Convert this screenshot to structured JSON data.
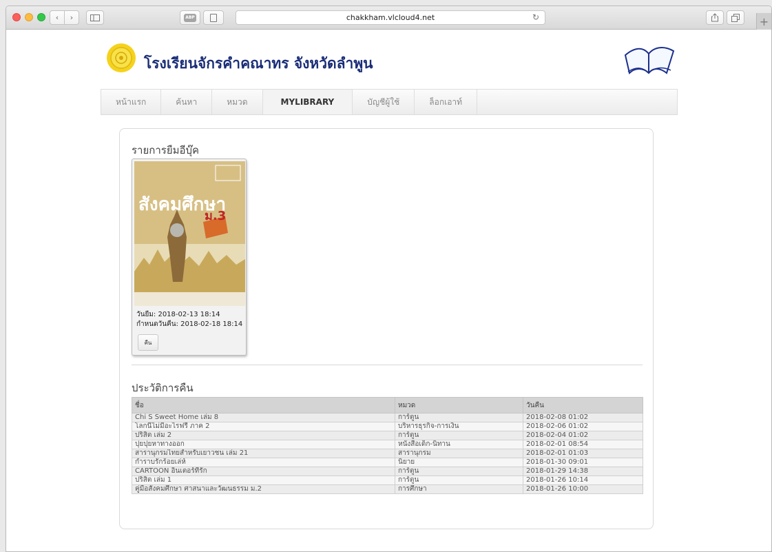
{
  "browser": {
    "url": "chakkham.vlcloud4.net",
    "abp_label": "ABP",
    "new_tab": "+"
  },
  "site": {
    "title": "โรงเรียนจักรคำคณาทร จังหวัดลำพูน"
  },
  "nav": {
    "items": [
      {
        "label": "หน้าแรก"
      },
      {
        "label": "ค้นหา"
      },
      {
        "label": "หมวด"
      },
      {
        "label": "MYLIBRARY",
        "active": true
      },
      {
        "label": "บัญชีผู้ใช้"
      },
      {
        "label": "ล็อกเอาท์"
      }
    ]
  },
  "loans": {
    "heading": "รายการยืมอีบุ๊ค",
    "book": {
      "cover_title": "สังคมศึกษา",
      "cover_grade": "ม.3",
      "borrow_date": "วันยืม: 2018-02-13 18:14",
      "due_date": "กำหนดวันคืน: 2018-02-18 18:14",
      "return_label": "คืน"
    }
  },
  "history": {
    "heading": "ประวัติการคืน",
    "columns": [
      "ชื่อ",
      "หมวด",
      "วันคืน"
    ],
    "rows": [
      [
        "Chi S Sweet Home เล่ม 8",
        "การ์ตูน",
        "2018-02-08 01:02"
      ],
      [
        "โลกนี้ไม่มีอะไรฟรี ภาค 2",
        "บริหารธุรกิจ-การเงิน",
        "2018-02-06 01:02"
      ],
      [
        "ปริสิต เล่ม 2",
        "การ์ตูน",
        "2018-02-04 01:02"
      ],
      [
        "ปุยปุยหาทางออก",
        "หนังสือเด็ก-นิทาน",
        "2018-02-01 08:54"
      ],
      [
        "สารานุกรมไทยสำหรับเยาวชน เล่ม 21",
        "สารานุกรม",
        "2018-02-01 01:03"
      ],
      [
        "กำราบรักร้อยเล่ห์",
        "นิยาย",
        "2018-01-30 09:01"
      ],
      [
        "CARTOON อินเตอร์ที่รัก",
        "การ์ตูน",
        "2018-01-29 14:38"
      ],
      [
        "ปริสิต เล่ม 1",
        "การ์ตูน",
        "2018-01-26 10:14"
      ],
      [
        "คู่มือสังคมศึกษา ศาสนาและวัฒนธรรม ม.2",
        "การศึกษา",
        "2018-01-26 10:00"
      ]
    ]
  },
  "colors": {
    "title": "#1a2d76",
    "logo": "#f5d21c",
    "book_cover": "#d7bf84"
  }
}
